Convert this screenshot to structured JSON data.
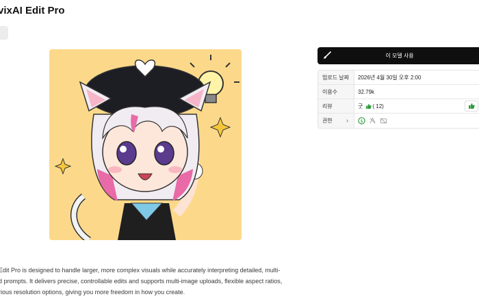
{
  "header": {
    "title": "vixAI Edit Pro"
  },
  "preview": {
    "image_description_icon": "anime-catgirl-image"
  },
  "actions": {
    "use_model_label": "이 모델 사용"
  },
  "info": {
    "upload_date_label": "업로드 날짜",
    "upload_date_value": "2026년 4월 30일 오후 2:00",
    "usage_label": "이용수",
    "usage_value": "32.79k",
    "review_label": "리뷰",
    "review_value": "굿",
    "review_count": "( 12)",
    "permissions_label": "권한"
  },
  "description": {
    "line1": "Edit Pro is designed to handle larger, more complex visuals while accurately interpreting detailed, multi-",
    "line2": "d prompts. It delivers precise, controllable edits and supports multi-image uploads, flexible aspect ratios,",
    "line3": "rious resolution options, giving you more freedom in how you create."
  },
  "colors": {
    "accent_green": "#2e9a3e",
    "button_dark": "#0f0f0f",
    "preview_bg": "#fcd98a"
  }
}
